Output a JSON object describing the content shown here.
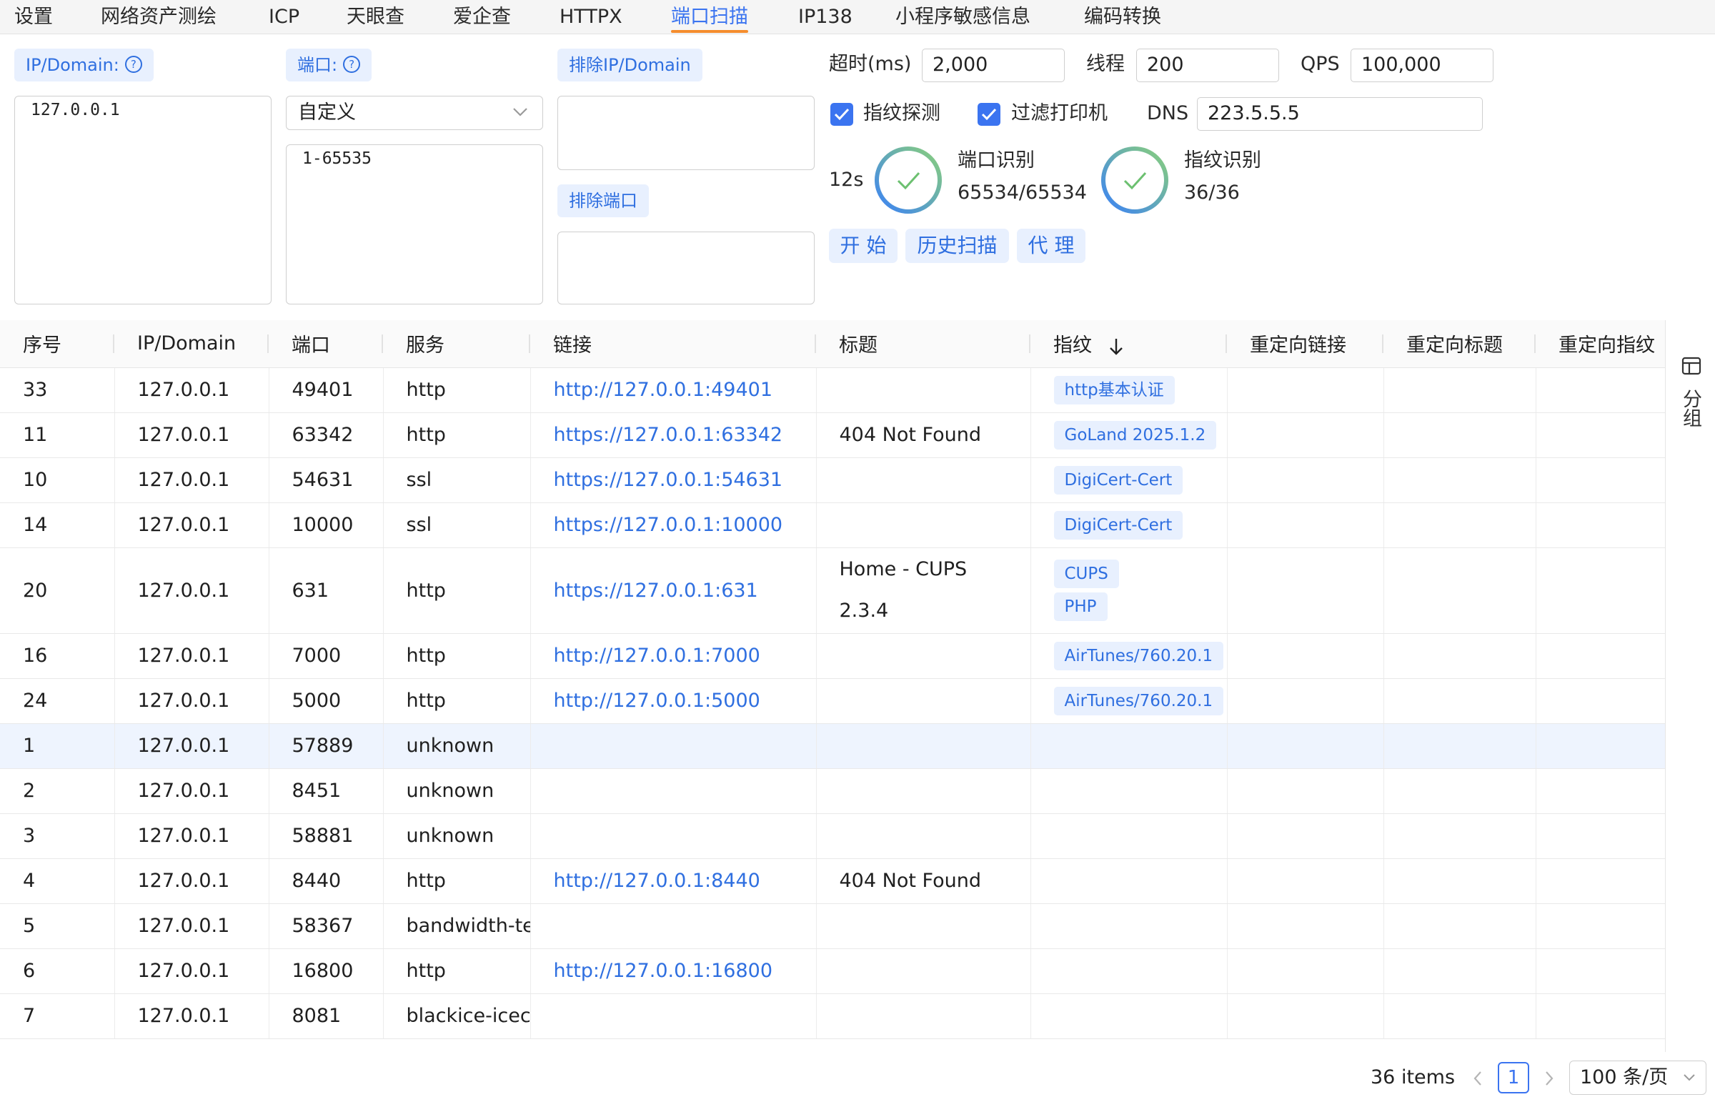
{
  "tabs": [
    "设置",
    "网络资产测绘",
    "ICP",
    "天眼查",
    "爱企查",
    "HTTPX",
    "端口扫描",
    "IP138",
    "小程序敏感信息",
    "编码转换"
  ],
  "active_tab": "端口扫描",
  "form": {
    "ip_label": "IP/Domain:",
    "ip_value": "127.0.0.1",
    "port_label": "端口:",
    "port_preset": "自定义",
    "port_value": "1-65535",
    "exclude_ip_label": "排除IP/Domain",
    "exclude_ip_value": "",
    "exclude_port_label": "排除端口",
    "exclude_port_value": "",
    "help_glyph": "?",
    "timeout_label": "超时(ms)",
    "timeout_value": "2,000",
    "threads_label": "线程",
    "threads_value": "200",
    "qps_label": "QPS",
    "qps_value": "100,000",
    "fingerprint_label": "指纹探测",
    "fingerprint_checked": true,
    "filter_printer_label": "过滤打印机",
    "filter_printer_checked": true,
    "dns_label": "DNS",
    "dns_value": "223.5.5.5"
  },
  "progress": {
    "elapsed": "12s",
    "port_title": "端口识别",
    "port_count": "65534/65534",
    "port_fraction": 1.0,
    "fp_title": "指纹识别",
    "fp_count": "36/36",
    "fp_fraction": 1.0
  },
  "buttons": {
    "start": "开 始",
    "history": "历史扫描",
    "proxy": "代 理"
  },
  "table": {
    "columns": [
      "序号",
      "IP/Domain",
      "端口",
      "服务",
      "链接",
      "标题",
      "指纹",
      "重定向链接",
      "重定向标题",
      "重定向指纹"
    ],
    "sort_column": "指纹",
    "sort_direction": "desc",
    "rows": [
      {
        "id": "33",
        "ip": "127.0.0.1",
        "port": "49401",
        "service": "http",
        "link": "http://127.0.0.1:49401",
        "title": [],
        "fingerprints": [
          "http基本认证"
        ]
      },
      {
        "id": "11",
        "ip": "127.0.0.1",
        "port": "63342",
        "service": "http",
        "link": "https://127.0.0.1:63342",
        "title": [
          "404 Not Found"
        ],
        "fingerprints": [
          "GoLand 2025.1.2"
        ]
      },
      {
        "id": "10",
        "ip": "127.0.0.1",
        "port": "54631",
        "service": "ssl",
        "link": "https://127.0.0.1:54631",
        "title": [],
        "fingerprints": [
          "DigiCert-Cert"
        ]
      },
      {
        "id": "14",
        "ip": "127.0.0.1",
        "port": "10000",
        "service": "ssl",
        "link": "https://127.0.0.1:10000",
        "title": [],
        "fingerprints": [
          "DigiCert-Cert"
        ]
      },
      {
        "id": "20",
        "ip": "127.0.0.1",
        "port": "631",
        "service": "http",
        "link": "https://127.0.0.1:631",
        "title": [
          "Home - CUPS",
          "2.3.4"
        ],
        "fingerprints": [
          "CUPS",
          "PHP"
        ]
      },
      {
        "id": "16",
        "ip": "127.0.0.1",
        "port": "7000",
        "service": "http",
        "link": "http://127.0.0.1:7000",
        "title": [],
        "fingerprints": [
          "AirTunes/760.20.1"
        ]
      },
      {
        "id": "24",
        "ip": "127.0.0.1",
        "port": "5000",
        "service": "http",
        "link": "http://127.0.0.1:5000",
        "title": [],
        "fingerprints": [
          "AirTunes/760.20.1"
        ]
      },
      {
        "id": "1",
        "ip": "127.0.0.1",
        "port": "57889",
        "service": "unknown",
        "link": "",
        "title": [],
        "fingerprints": [],
        "highlighted": true
      },
      {
        "id": "2",
        "ip": "127.0.0.1",
        "port": "8451",
        "service": "unknown",
        "link": "",
        "title": [],
        "fingerprints": []
      },
      {
        "id": "3",
        "ip": "127.0.0.1",
        "port": "58881",
        "service": "unknown",
        "link": "",
        "title": [],
        "fingerprints": []
      },
      {
        "id": "4",
        "ip": "127.0.0.1",
        "port": "8440",
        "service": "http",
        "link": "http://127.0.0.1:8440",
        "title": [
          "404 Not Found"
        ],
        "fingerprints": []
      },
      {
        "id": "5",
        "ip": "127.0.0.1",
        "port": "58367",
        "service": "bandwidth-te",
        "link": "",
        "title": [],
        "fingerprints": []
      },
      {
        "id": "6",
        "ip": "127.0.0.1",
        "port": "16800",
        "service": "http",
        "link": "http://127.0.0.1:16800",
        "title": [],
        "fingerprints": []
      },
      {
        "id": "7",
        "ip": "127.0.0.1",
        "port": "8081",
        "service": "blackice-icec",
        "link": "",
        "title": [],
        "fingerprints": []
      }
    ]
  },
  "group_panel": {
    "label": "分组",
    "icon": "table-icon"
  },
  "footer": {
    "total": "36 items",
    "current_page": "1",
    "page_size": "100 条/页"
  },
  "colors": {
    "accent": "#3b74f0",
    "tag_bg": "#e8f0fe",
    "link": "#2f6fe0",
    "tab_underline": "#f58d2d",
    "ring_green": "#6cc070",
    "ring_blue": "#3b82f6"
  }
}
